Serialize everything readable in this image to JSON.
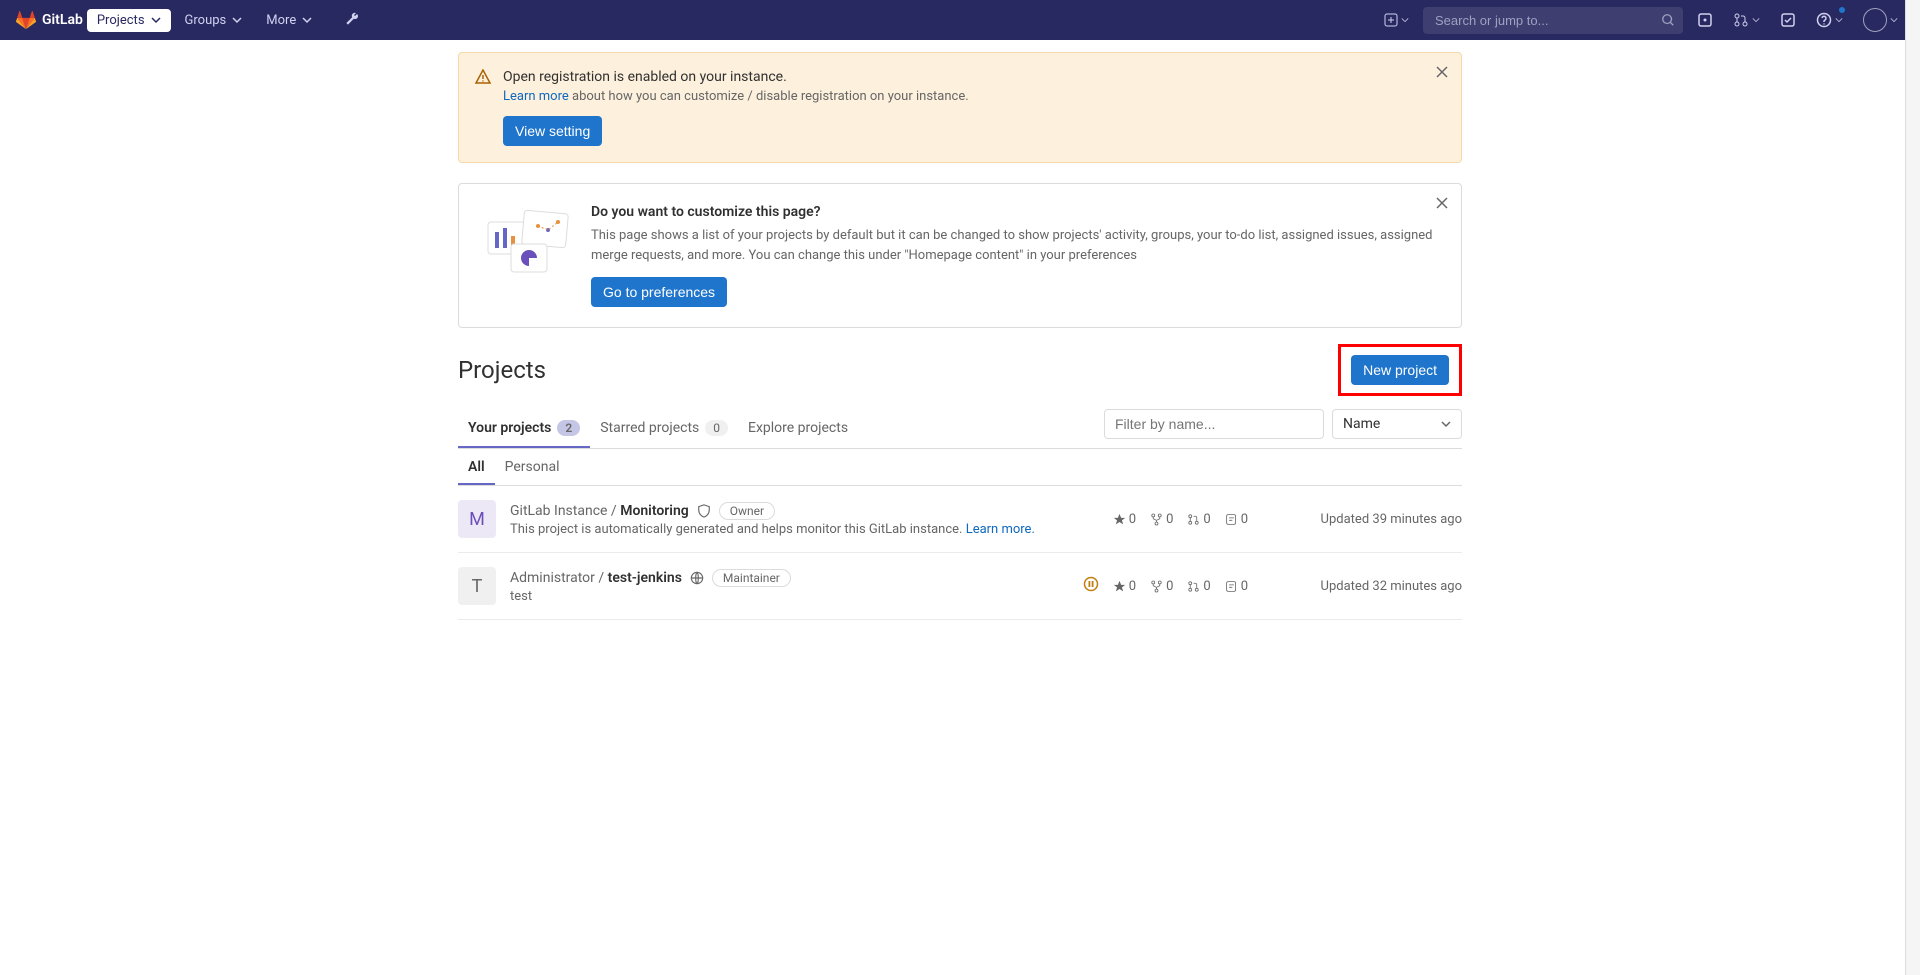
{
  "nav": {
    "brand": "GitLab",
    "projects": "Projects",
    "groups": "Groups",
    "more": "More",
    "search_placeholder": "Search or jump to..."
  },
  "alerts": {
    "registration": {
      "title": "Open registration is enabled on your instance.",
      "learn_more": "Learn more",
      "text_after": " about how you can customize / disable registration on your instance.",
      "button": "View setting"
    },
    "customize": {
      "title": "Do you want to customize this page?",
      "text": "This page shows a list of your projects by default but it can be changed to show projects' activity, groups, your to-do list, assigned issues, assigned merge requests, and more. You can change this under \"Homepage content\" in your preferences",
      "button": "Go to preferences"
    }
  },
  "page": {
    "title": "Projects",
    "new_project": "New project"
  },
  "tabs": {
    "your": {
      "label": "Your projects",
      "count": "2"
    },
    "starred": {
      "label": "Starred projects",
      "count": "0"
    },
    "explore": {
      "label": "Explore projects"
    }
  },
  "filter": {
    "placeholder": "Filter by name...",
    "sort": "Name"
  },
  "subtabs": {
    "all": "All",
    "personal": "Personal"
  },
  "projects": [
    {
      "avatar_letter": "M",
      "avatar_color": "purple",
      "path": "GitLab Instance / ",
      "name": "Monitoring",
      "visibility": "internal",
      "role": "Owner",
      "has_status": false,
      "desc_text": "This project is automatically generated and helps monitor this GitLab instance. ",
      "desc_link": "Learn more.",
      "stars": "0",
      "forks": "0",
      "mrs": "0",
      "issues": "0",
      "updated": "Updated 39 minutes ago"
    },
    {
      "avatar_letter": "T",
      "avatar_color": "gray",
      "path": "Administrator / ",
      "name": "test-jenkins",
      "visibility": "public",
      "role": "Maintainer",
      "has_status": true,
      "desc_text": "test",
      "desc_link": "",
      "stars": "0",
      "forks": "0",
      "mrs": "0",
      "issues": "0",
      "updated": "Updated 32 minutes ago"
    }
  ]
}
